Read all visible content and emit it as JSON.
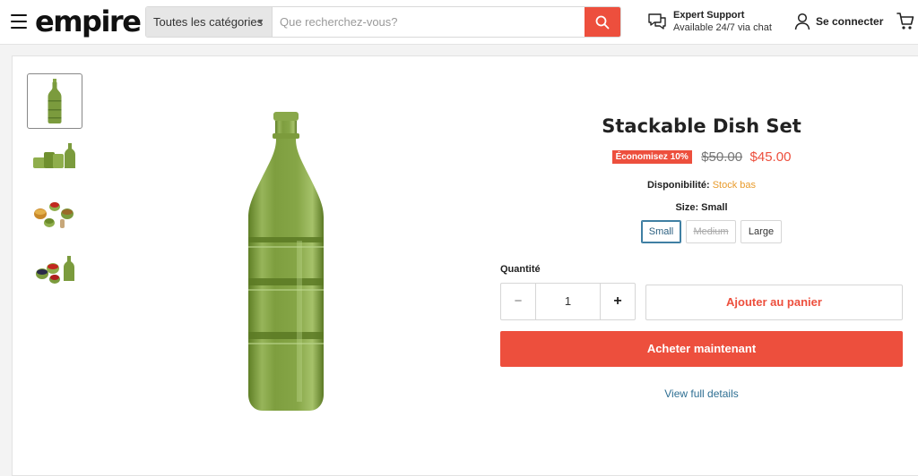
{
  "header": {
    "logo": "empire",
    "search": {
      "category": "Toutes les catégories",
      "placeholder": "Que recherchez-vous?"
    },
    "support": {
      "title": "Expert Support",
      "subtitle": "Available 24/7 via chat"
    },
    "login_label": "Se connecter"
  },
  "product": {
    "title": "Stackable Dish Set",
    "badge": "Économisez 10%",
    "old_price": "$50.00",
    "price": "$45.00",
    "availability_label": "Disponibilité:",
    "availability_value": "Stock bas",
    "size_label": "Size: Small",
    "sizes": [
      "Small",
      "Medium",
      "Large"
    ],
    "quantity_label": "Quantité",
    "quantity": "1",
    "minus": "−",
    "plus": "+",
    "add_to_cart": "Ajouter au panier",
    "buy_now": "Acheter maintenant",
    "full_details": "View full details"
  },
  "colors": {
    "accent": "#ed4f3d",
    "link": "#2e6f93",
    "stock": "#e89b2c",
    "glass": "#7a9a3c"
  }
}
